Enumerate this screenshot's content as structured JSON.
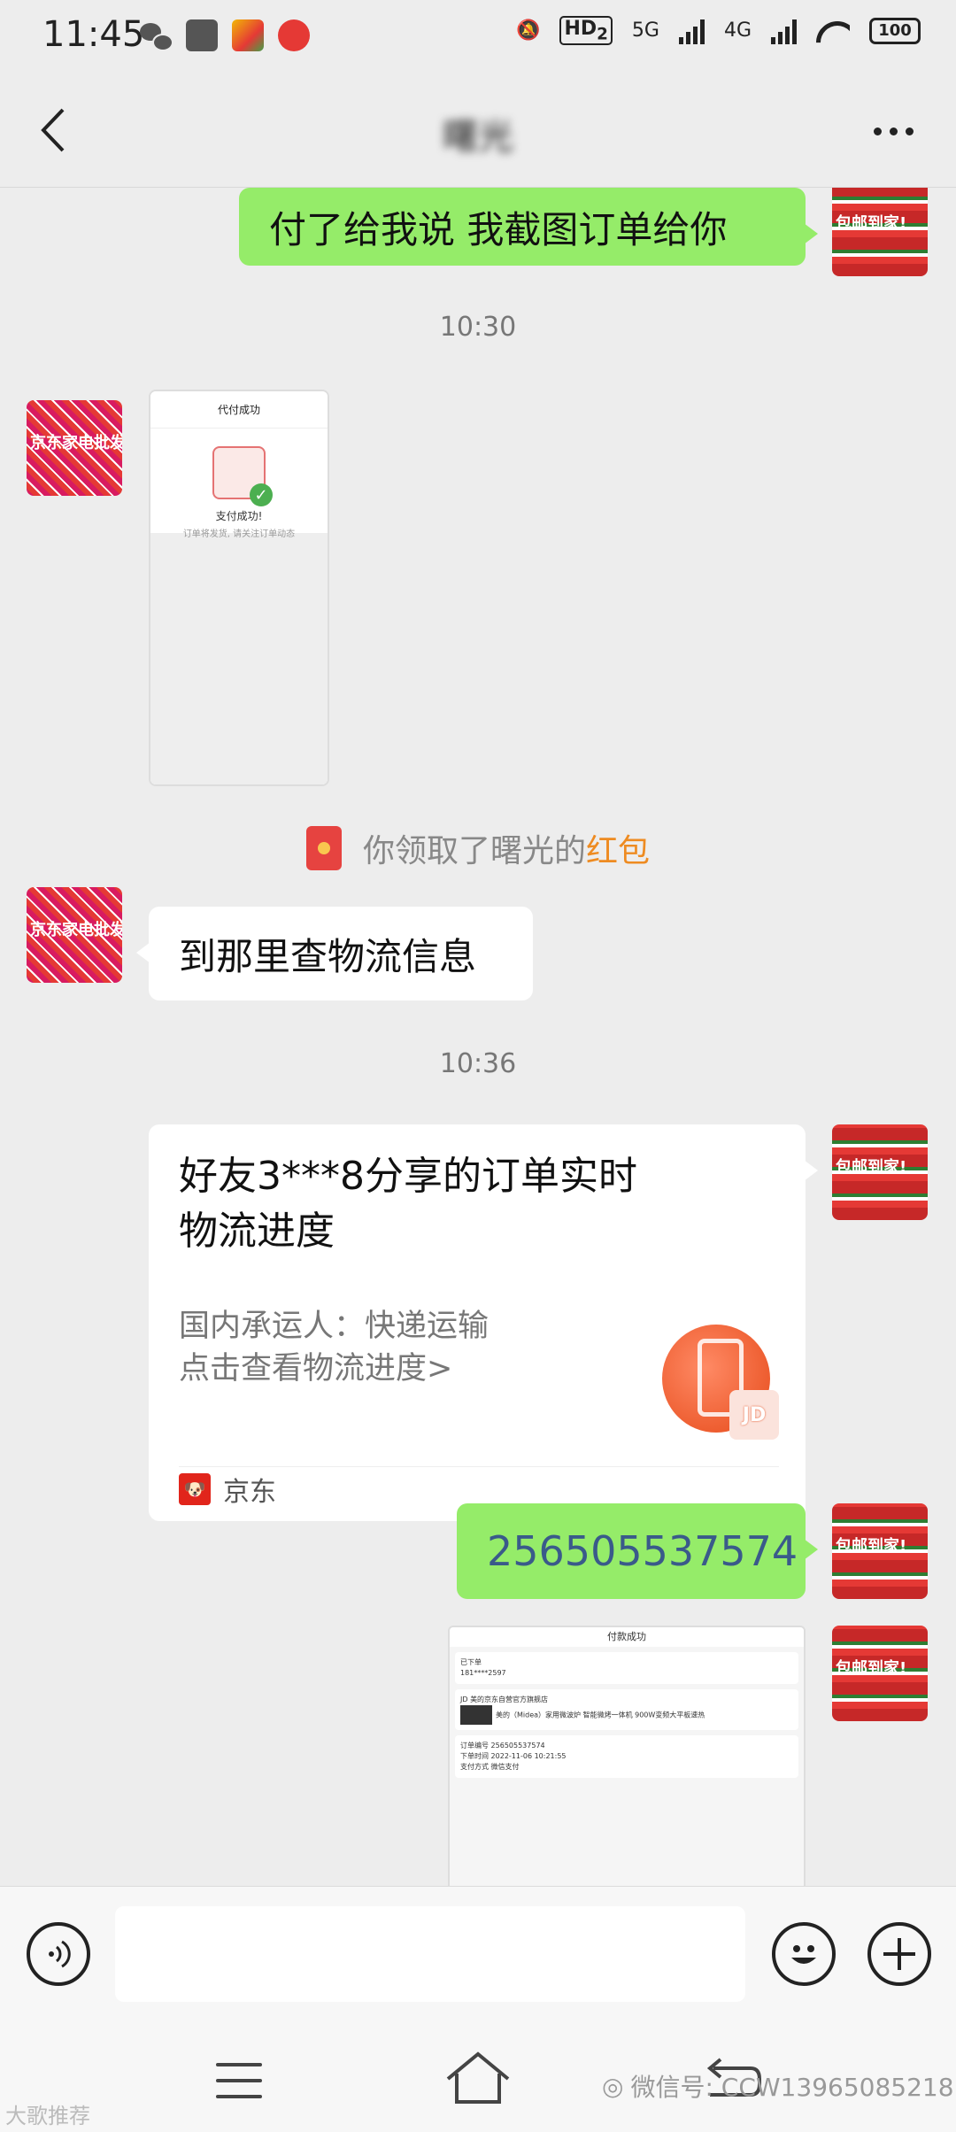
{
  "status_bar": {
    "time": "11:45",
    "network_5g": "5G",
    "network_4g": "4G",
    "hd_label": "HD",
    "hd_sub": "2",
    "battery": "100",
    "app_icons": [
      "wechat-icon",
      "scissors-app-icon",
      "58-app-icon",
      "map-app-icon"
    ]
  },
  "nav": {
    "title": "曙光",
    "back_icon": "chevron-left-icon",
    "more_icon": "more-dots-icon"
  },
  "messages": {
    "m1_text": "付了给我说  我截图订单给你",
    "time1": "10:30",
    "payment_shot": {
      "header": "代付成功",
      "status": "支付成功!",
      "sub": "订单将发货, 请关注订单动态"
    },
    "red_packet": {
      "prefix": "你领取了曙光的",
      "link": "红包"
    },
    "m3_text": "到那里查物流信息",
    "time2": "10:36",
    "card": {
      "title": "好友3***8分享的订单实时物流进度",
      "line1": "国内承运人：快递运输",
      "line2": "点击查看物流进度>",
      "thumb_badge": "JD",
      "source": "京东"
    },
    "m5_text": "256505537574",
    "receipt": {
      "header": "付款成功",
      "order_label": "已下单",
      "phone": "181****2597",
      "store": "JD 美的京东自营官方旗舰店",
      "product": "美的（Midea）家用微波炉 智能微烤一体机 900W变频大平板速热",
      "order_no_label": "订单编号",
      "order_no": "256505537574",
      "time_label": "下单时间",
      "time": "2022-11-06 10:21:55",
      "pay_label": "支付方式",
      "pay": "微信支付"
    }
  },
  "avatars": {
    "self_label": "包邮到家!",
    "other_label": "京东家电批发"
  },
  "input_bar": {
    "voice_icon": "voice-icon",
    "emoji_icon": "emoji-icon",
    "plus_icon": "plus-icon"
  },
  "watermarks": {
    "left": "大歌推荐",
    "right": "微信号: CCW13965085218"
  }
}
